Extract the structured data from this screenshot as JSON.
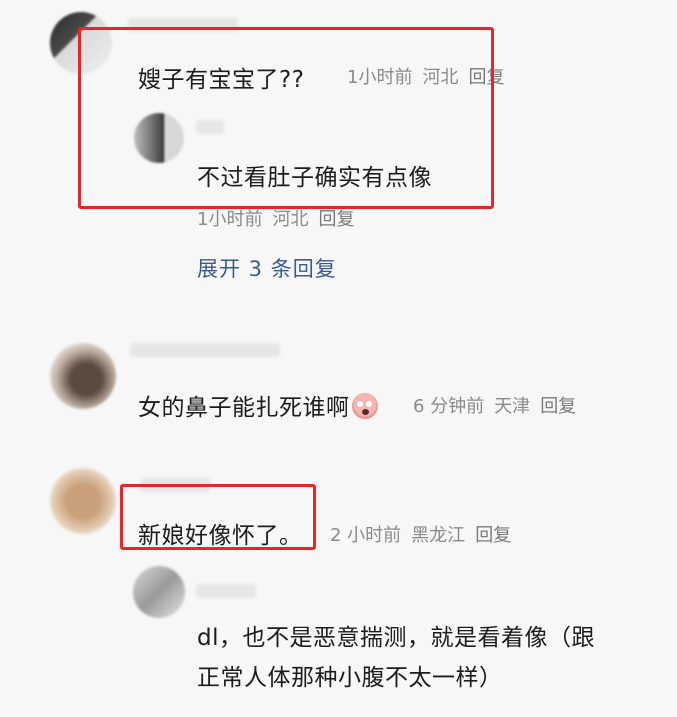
{
  "thread1": {
    "comment": "嫂子有宝宝了??",
    "time": "1小时前",
    "location": "河北",
    "reply_label": "回复",
    "sub_reply": {
      "comment": "不过看肚子确实有点像",
      "time": "1小时前",
      "location": "河北",
      "reply_label": "回复"
    },
    "expand_label": "展开 3 条回复"
  },
  "thread2": {
    "comment": "女的鼻子能扎死谁啊",
    "emoji_icon": "crying-face-emoji",
    "time": "6 分钟前",
    "location": "天津",
    "reply_label": "回复"
  },
  "thread3": {
    "comment": "新娘好像怀了。",
    "time": "2 小时前",
    "location": "黑龙江",
    "reply_label": "回复",
    "sub_reply": {
      "comment_line1": "dl，也不是恶意揣测，就是看着像（跟",
      "comment_line2": "正常人体那种小腹不太一样）"
    }
  },
  "colors": {
    "highlight_box": "#e8262a",
    "link": "#3a5a95",
    "meta": "#8a8a8a",
    "background": "#f7f7f7"
  }
}
